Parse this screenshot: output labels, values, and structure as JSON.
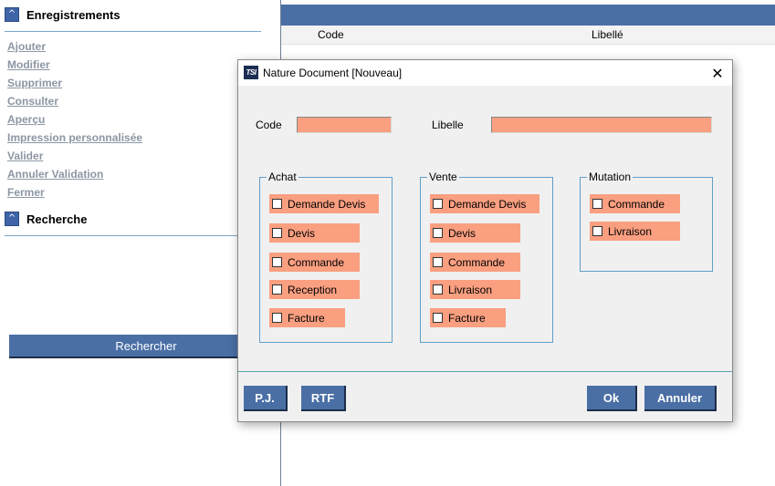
{
  "sidebar": {
    "records": {
      "title": "Enregistrements",
      "items": [
        {
          "label": "Ajouter"
        },
        {
          "label": "Modifier"
        },
        {
          "label": "Supprimer"
        },
        {
          "label": "Consulter"
        },
        {
          "label": "Aperçu"
        },
        {
          "label": "Impression personnalisée"
        },
        {
          "label": "Valider"
        },
        {
          "label": "Annuler Validation"
        },
        {
          "label": "Fermer"
        }
      ]
    },
    "search": {
      "title": "Recherche",
      "button_label": "Rechercher"
    },
    "toggle_icon": "collapse-caret-icon"
  },
  "grid": {
    "columns": [
      "Code",
      "Libellé"
    ]
  },
  "dialog": {
    "icon_text": "TSI",
    "title": "Nature Document [Nouveau]",
    "close_glyph": "✕",
    "code": {
      "label": "Code",
      "value": ""
    },
    "libelle": {
      "label": "Libelle",
      "value": ""
    },
    "groups": {
      "achat": {
        "title": "Achat",
        "items": [
          {
            "label": "Demande Devis",
            "checked": false
          },
          {
            "label": "Devis",
            "checked": false
          },
          {
            "label": "Commande",
            "checked": false
          },
          {
            "label": "Reception",
            "checked": false
          },
          {
            "label": "Facture",
            "checked": false
          }
        ]
      },
      "vente": {
        "title": "Vente",
        "items": [
          {
            "label": "Demande Devis",
            "checked": false
          },
          {
            "label": "Devis",
            "checked": false
          },
          {
            "label": "Commande",
            "checked": false
          },
          {
            "label": "Livraison",
            "checked": false
          },
          {
            "label": "Facture",
            "checked": false
          }
        ]
      },
      "mutation": {
        "title": "Mutation",
        "items": [
          {
            "label": "Commande",
            "checked": false
          },
          {
            "label": "Livraison",
            "checked": false
          }
        ]
      }
    },
    "buttons": {
      "pj": "P.J.",
      "rtf": "RTF",
      "ok": "Ok",
      "cancel": "Annuler"
    }
  },
  "colors": {
    "accent_blue": "#4a6fa5",
    "field_salmon": "#fa9f80",
    "group_border": "#5f9ec9"
  }
}
